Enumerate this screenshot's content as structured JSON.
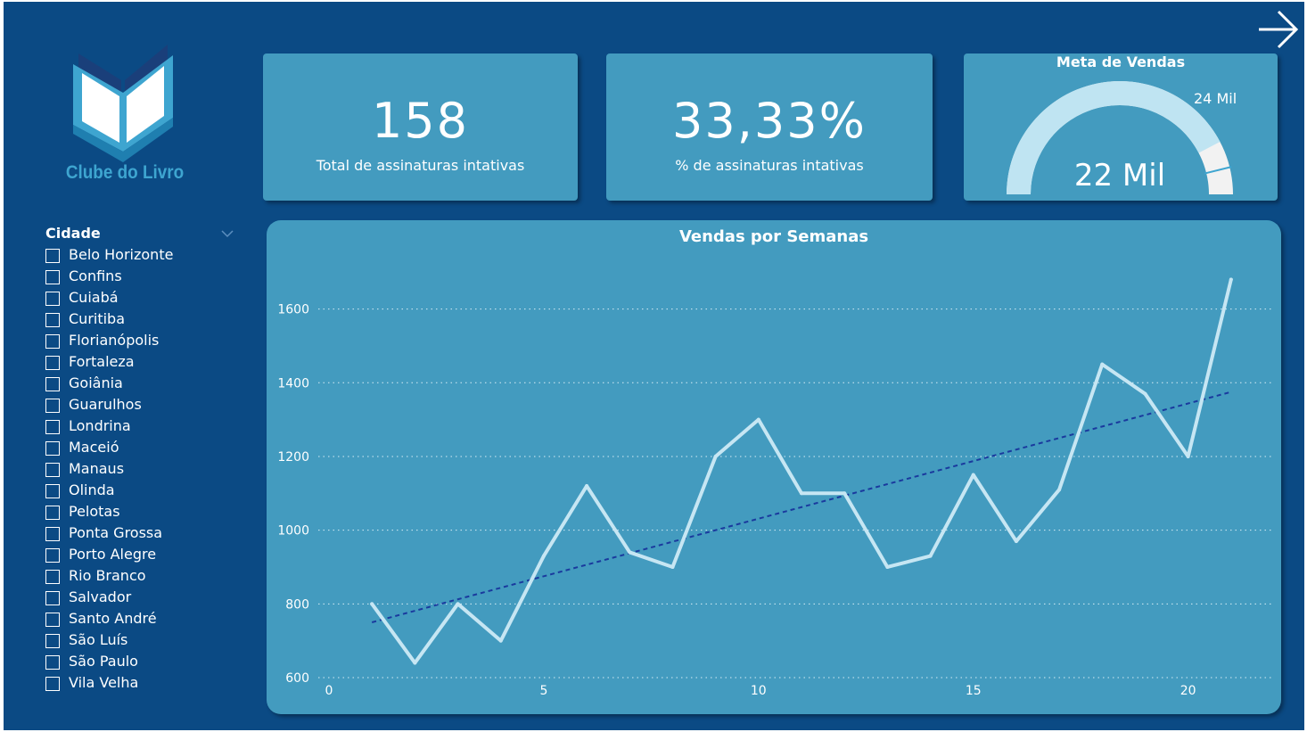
{
  "app": {
    "logo_text": "Clube do Livro",
    "icons": {
      "logo": "open-book-icon",
      "next": "arrow-right-icon",
      "dropdown": "chevron-down-icon"
    }
  },
  "kpis": [
    {
      "value": "158",
      "label": "Total de assinaturas intativas"
    },
    {
      "value": "33,33%",
      "label": "% de assinaturas intativas"
    }
  ],
  "gauge": {
    "title": "Meta de Vendas",
    "value_label": "22 Mil",
    "target_label": "24 Mil",
    "value": 22000,
    "target": 24000,
    "max": 26000,
    "colors": {
      "fill": "#bfe4f2",
      "remainder": "#f2f2f2",
      "target_line": "#3ea5d0"
    }
  },
  "slicer": {
    "title": "Cidade",
    "items": [
      "Belo Horizonte",
      "Confins",
      "Cuiabá",
      "Curitiba",
      "Florianópolis",
      "Fortaleza",
      "Goiânia",
      "Guarulhos",
      "Londrina",
      "Maceió",
      "Manaus",
      "Olinda",
      "Pelotas",
      "Ponta Grossa",
      "Porto Alegre",
      "Rio Branco",
      "Salvador",
      "Santo André",
      "São Luís",
      "São Paulo",
      "Vila Velha"
    ]
  },
  "chart_data": {
    "type": "line",
    "title": "Vendas por Semanas",
    "x": [
      1,
      2,
      3,
      4,
      5,
      6,
      7,
      8,
      9,
      10,
      11,
      12,
      13,
      14,
      15,
      16,
      17,
      18,
      19,
      20,
      21
    ],
    "series": [
      {
        "values": [
          800,
          640,
          800,
          700,
          930,
          1120,
          940,
          900,
          1200,
          1300,
          1100,
          1100,
          900,
          930,
          1150,
          970,
          1110,
          1450,
          1370,
          1200,
          1680
        ]
      }
    ],
    "trendline": {
      "from": [
        1,
        750
      ],
      "to": [
        21,
        1375
      ],
      "style": "dashed"
    },
    "xlim": [
      0,
      22
    ],
    "ylim": [
      600,
      1720
    ],
    "x_ticks": [
      0,
      5,
      10,
      15,
      20
    ],
    "y_ticks": [
      600,
      800,
      1000,
      1200,
      1400,
      1600
    ],
    "grid": "horizontal-dotted",
    "colors": {
      "line": "#c6e6f3",
      "trend": "#1a3a9e",
      "grid": "#d6ecf5"
    }
  }
}
